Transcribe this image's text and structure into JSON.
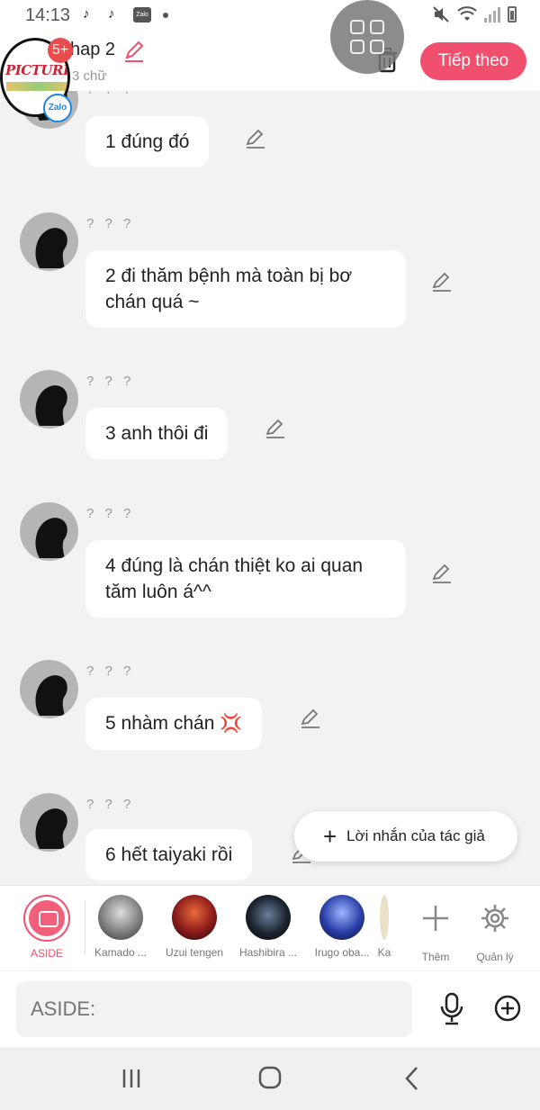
{
  "status_bar": {
    "time": "14:13",
    "notif_app": "Zalo"
  },
  "header": {
    "chapter_title": "hap 2",
    "word_count": "3 chữ",
    "next_button": "Tiếp theo",
    "badge_count": "5+",
    "bubble_picture_text": "PICTURE",
    "bubble_app": "Zalo"
  },
  "messages": [
    {
      "sender": "? ? ?",
      "text": "1 đúng đó"
    },
    {
      "sender": "? ? ?",
      "text": "2 đi thăm bệnh mà toàn bị bơ chán quá ~"
    },
    {
      "sender": "? ? ?",
      "text": "3 anh thôi đi"
    },
    {
      "sender": "? ? ?",
      "text": "4 đúng là chán thiệt ko ai quan tăm luôn á^^"
    },
    {
      "sender": "? ? ?",
      "text": "5 nhàm chán",
      "emoji": "💢"
    },
    {
      "sender": "? ? ?",
      "text": "6 hết taiyaki rồi"
    }
  ],
  "author_note": "Lời nhắn của tác giả",
  "characters": {
    "aside": "ASIDE",
    "items": [
      "Kamado ...",
      "Uzui tengen",
      "Hashibira ...",
      "Irugo oba...",
      "Ka"
    ],
    "more": "Thêm",
    "manage": "Quản lý"
  },
  "input": {
    "placeholder": "ASIDE:"
  },
  "colors": {
    "accent": "#f0506e",
    "bubble": "#ffffff",
    "background": "#f2f2f2"
  }
}
